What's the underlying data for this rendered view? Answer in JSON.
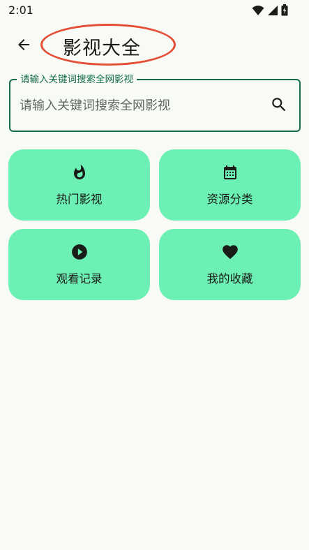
{
  "status_bar": {
    "time": "2:01",
    "icons": [
      "wifi-icon",
      "signal-icon",
      "battery-icon"
    ]
  },
  "app_bar": {
    "back_icon": "arrow-left-icon",
    "title": "影视大全"
  },
  "search": {
    "legend": "请输入关键词搜索全网影视",
    "placeholder": "请输入关键词搜索全网影视",
    "value": "",
    "icon": "search-icon"
  },
  "tiles": [
    {
      "label": "热门影视",
      "icon": "fire-icon"
    },
    {
      "label": "资源分类",
      "icon": "calendar-icon"
    },
    {
      "label": "观看记录",
      "icon": "play-circle-icon"
    },
    {
      "label": "我的收藏",
      "icon": "heart-icon"
    }
  ],
  "colors": {
    "background": "#f8fbf5",
    "primary": "#146c4e",
    "tile": "#6cf0b3",
    "annotation": "#e54d36"
  }
}
